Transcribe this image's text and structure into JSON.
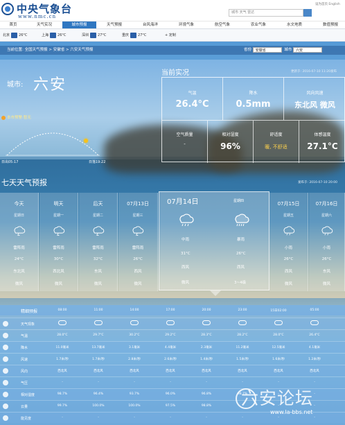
{
  "header": {
    "logo_main": "中央气象台",
    "logo_sub": "www.nmc.cn",
    "search_placeholder": "城市 天气 雷达",
    "top_links": "设为首页  English"
  },
  "nav": {
    "items": [
      "首页",
      "天气实况",
      "城市预报",
      "天气预报",
      "台风海洋",
      "环境气象",
      "航空气象",
      "农业气象",
      "水文地质",
      "数值预报"
    ],
    "active_index": 2
  },
  "quick_cities": [
    {
      "name": "北京",
      "temp": "26°C"
    },
    {
      "name": "上海",
      "temp": "26°C"
    },
    {
      "name": "深圳",
      "temp": "27°C"
    },
    {
      "name": "重庆",
      "temp": "27°C"
    }
  ],
  "quick_custom": "+ 定制",
  "locbar": {
    "path": "当前位置: 全国天气预报 > 安徽省 > 六安天气预报",
    "province_label": "省份",
    "province": "安徽省",
    "city_label": "城市",
    "city": "六安"
  },
  "city": {
    "label": "城市:",
    "name": "六安",
    "alert": "本市预警:暂无",
    "sunrise": "日出05:17",
    "sunset": "日落19:22"
  },
  "current": {
    "title": "当前实况",
    "update": "更新于: 2016-07-10 11:20发布",
    "temp_label": "气温",
    "temp": "26.4°C",
    "precip_label": "降水",
    "precip": "0.5mm",
    "wind_label": "风向风速",
    "wind": "东北风 微风",
    "aqi_label": "空气质量",
    "aqi": "-",
    "humidity_label": "相对湿度",
    "humidity": "96%",
    "comfort_label": "舒适度",
    "comfort": "暖, 不舒适",
    "feels_label": "体感温度",
    "feels": "27.1°C"
  },
  "seven": {
    "title": "七天天气预报",
    "published": "发布于: 2016-07-10 20:00",
    "days": [
      {
        "date": "今天",
        "week": "星期日",
        "weather": "雷阵雨",
        "temp": "24°C",
        "wind_dir": "东北风",
        "wind_speed": "微风"
      },
      {
        "date": "明天",
        "week": "星期一",
        "weather": "雷阵雨",
        "temp": "30°C",
        "wind_dir": "西北风",
        "wind_speed": "微风"
      },
      {
        "date": "后天",
        "week": "星期二",
        "weather": "雷阵雨",
        "temp": "32°C",
        "wind_dir": "东风",
        "wind_speed": "微风"
      },
      {
        "date": "07月13日",
        "week": "星期三",
        "weather": "雷阵雨",
        "temp": "26°C",
        "wind_dir": "西风",
        "wind_speed": "微风"
      },
      {
        "date": "07月15日",
        "week": "星期五",
        "weather": "小雨",
        "temp": "26°C",
        "wind_dir": "西风",
        "wind_speed": "微风"
      },
      {
        "date": "07月16日",
        "week": "星期六",
        "weather": "小雨",
        "temp": "26°C",
        "wind_dir": "东风",
        "wind_speed": "微风"
      }
    ],
    "big": {
      "date": "07月14日",
      "week": "星期四",
      "day_weather": "中雨",
      "day_temp": "31°C",
      "day_wind_dir": "西风",
      "day_wind_speed": "微风",
      "night_weather": "暴雨",
      "night_temp": "26°C",
      "night_wind_dir": "西风",
      "night_wind_speed": "3~4级"
    }
  },
  "hourly": {
    "title": "精细预报",
    "times": [
      "08:00",
      "11:00",
      "14:00",
      "17:00",
      "20:00",
      "23:00",
      "15日02:00",
      "05:00"
    ],
    "rows": [
      {
        "label": "天气现象",
        "values": [
          "",
          "",
          "",
          "",
          "",
          "",
          "",
          ""
        ]
      },
      {
        "label": "气温",
        "values": [
          "28.0°C",
          "29.7°C",
          "30.2°C",
          "29.2°C",
          "28.3°C",
          "28.2°C",
          "28.0°C",
          "26.4°C"
        ]
      },
      {
        "label": "降水",
        "values": [
          "11.0毫米",
          "13.7毫米",
          "3.1毫米",
          "4.4毫米",
          "2.3毫米",
          "11.2毫米",
          "12.5毫米",
          "4.1毫米"
        ]
      },
      {
        "label": "风速",
        "values": [
          "1.7米/秒",
          "1.7米/秒",
          "2.8米/秒",
          "2.6米/秒",
          "1.4米/秒",
          "1.5米/秒",
          "1.6米/秒",
          "1.2米/秒"
        ]
      },
      {
        "label": "风向",
        "values": [
          "西北风",
          "西北风",
          "西北风",
          "西北风",
          "西北风",
          "西北风",
          "西北风",
          "西北风"
        ]
      },
      {
        "label": "气压",
        "values": [
          "-",
          "-",
          "-",
          "-",
          "-",
          "-",
          "-",
          "-"
        ]
      },
      {
        "label": "相对湿度",
        "values": [
          "98.7%",
          "96.4%",
          "93.7%",
          "96.0%",
          "96.8%",
          "98.7%",
          "-",
          "-"
        ]
      },
      {
        "label": "云量",
        "values": [
          "99.7%",
          "100.0%",
          "100.0%",
          "97.5%",
          "98.8%",
          "-",
          "-",
          "-"
        ]
      },
      {
        "label": "能见度",
        "values": [
          "-",
          "-",
          "-",
          "-",
          "-",
          "-",
          "-",
          "-"
        ]
      }
    ]
  },
  "watermark": {
    "text": "六安论坛",
    "url": "www.la-bbs.net"
  },
  "colors": {
    "nav_active": "#2f77c1",
    "logo": "#1b4f93",
    "comfort": "#ffd34d",
    "sun": "#f6c21c"
  }
}
